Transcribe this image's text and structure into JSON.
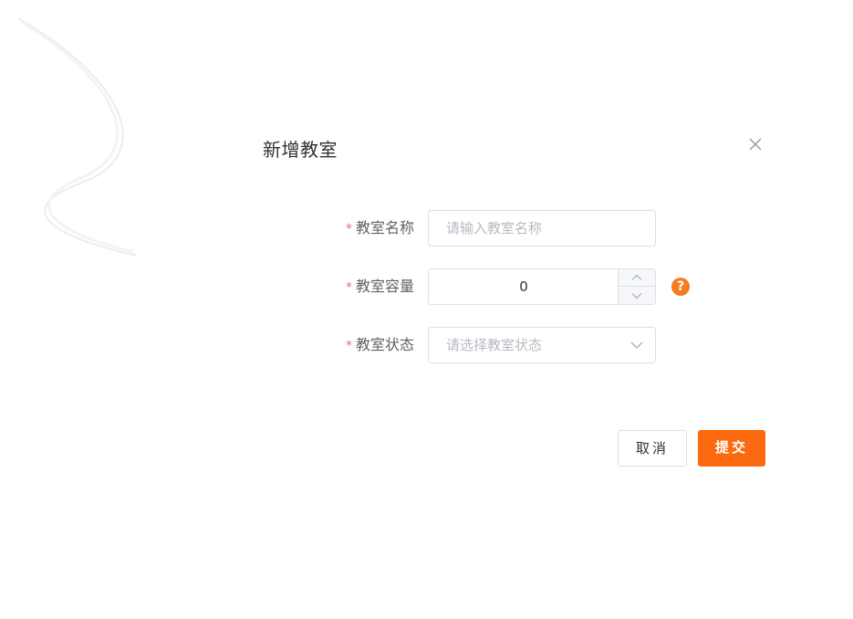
{
  "dialog": {
    "title": "新增教室",
    "close_icon": "close-icon"
  },
  "form": {
    "name_field": {
      "required_mark": "*",
      "label": "教室名称",
      "placeholder": "请输入教室名称",
      "value": ""
    },
    "capacity_field": {
      "required_mark": "*",
      "label": "教室容量",
      "value": "0",
      "help_icon_text": "?"
    },
    "status_field": {
      "required_mark": "*",
      "label": "教室状态",
      "placeholder": "请选择教室状态",
      "value": ""
    }
  },
  "footer": {
    "cancel_label": "取消",
    "submit_label": "提交"
  },
  "colors": {
    "accent": "#fb6a0e",
    "help_icon": "#f57c1f",
    "required": "#f56c6c",
    "border": "#dcdfe6",
    "placeholder": "#b6bac2"
  }
}
